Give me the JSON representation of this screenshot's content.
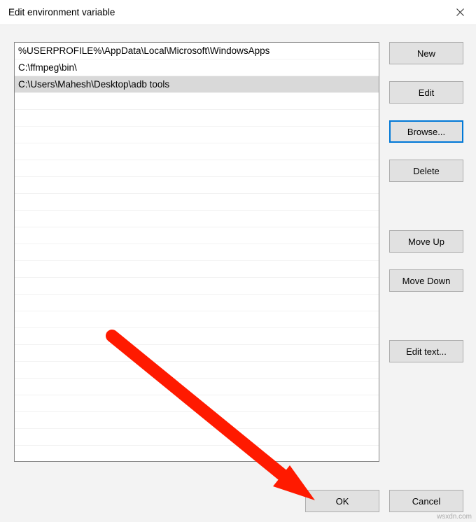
{
  "window": {
    "title": "Edit environment variable"
  },
  "paths": {
    "items": [
      {
        "value": "%USERPROFILE%\\AppData\\Local\\Microsoft\\WindowsApps",
        "selected": false
      },
      {
        "value": "C:\\ffmpeg\\bin\\",
        "selected": false
      },
      {
        "value": "C:\\Users\\Mahesh\\Desktop\\adb tools",
        "selected": true
      }
    ]
  },
  "buttons": {
    "new": "New",
    "edit": "Edit",
    "browse": "Browse...",
    "delete": "Delete",
    "move_up": "Move Up",
    "move_down": "Move Down",
    "edit_text": "Edit text...",
    "ok": "OK",
    "cancel": "Cancel"
  },
  "watermark": "wsxdn.com"
}
